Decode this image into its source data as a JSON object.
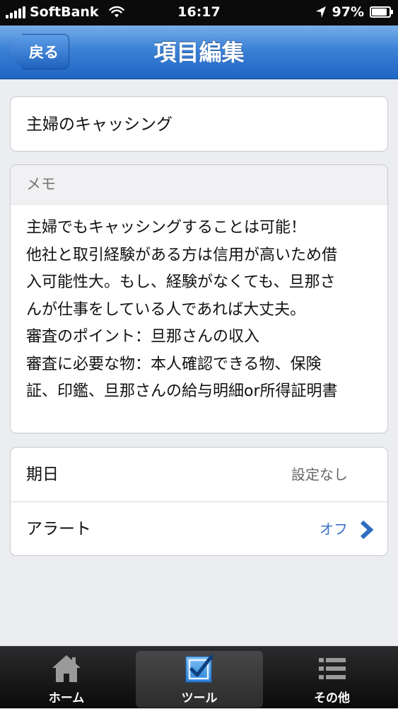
{
  "status_bar": {
    "carrier": "SoftBank",
    "time": "16:17",
    "battery_percent": "97%",
    "battery_level": 0.97
  },
  "nav": {
    "back_label": "戻る",
    "title": "項目編集"
  },
  "item": {
    "title": "主婦のキャッシング"
  },
  "memo": {
    "header": "メモ",
    "body": "主婦でもキャッシングすることは可能！\n他社と取引経験がある方は信用が高いため借\n入可能性大。もし、経験がなくても、旦那さ\nんが仕事をしている人であれば大丈夫。\n審査のポイント：旦那さんの収入\n審査に必要な物：本人確認できる物、保険\n証、印鑑、旦那さんの給与明細or所得証明書"
  },
  "settings": {
    "due_date_label": "期日",
    "due_date_value": "設定なし",
    "alert_label": "アラート",
    "alert_value": "オフ"
  },
  "tabs": [
    {
      "label": "ホーム",
      "icon": "home-icon",
      "active": false
    },
    {
      "label": "ツール",
      "icon": "checkbox-icon",
      "active": true
    },
    {
      "label": "その他",
      "icon": "list-icon",
      "active": false
    }
  ],
  "colors": {
    "nav_blue": "#2f75cf",
    "accent_blue": "#3a74c8",
    "tab_bar": "#141415"
  }
}
